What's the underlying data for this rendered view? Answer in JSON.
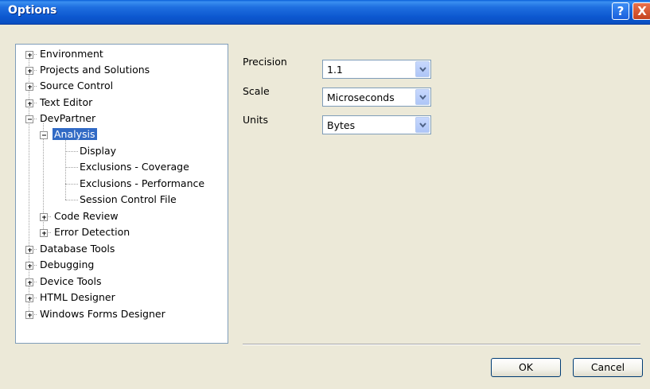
{
  "window": {
    "title": "Options"
  },
  "titlebar": {
    "help_glyph": "?",
    "close_glyph": "X"
  },
  "tree": {
    "items": [
      {
        "label": "Environment"
      },
      {
        "label": "Projects and Solutions"
      },
      {
        "label": "Source Control"
      },
      {
        "label": "Text Editor"
      },
      {
        "label": "DevPartner"
      },
      {
        "label": "Analysis",
        "selected": true
      },
      {
        "label": "Display"
      },
      {
        "label": "Exclusions - Coverage"
      },
      {
        "label": "Exclusions - Performance"
      },
      {
        "label": "Session Control File"
      },
      {
        "label": "Code Review"
      },
      {
        "label": "Error Detection"
      },
      {
        "label": "Database Tools"
      },
      {
        "label": "Debugging"
      },
      {
        "label": "Device Tools"
      },
      {
        "label": "HTML Designer"
      },
      {
        "label": "Windows Forms Designer"
      }
    ]
  },
  "settings": {
    "precision": {
      "label": "Precision",
      "value": "1.1"
    },
    "scale": {
      "label": "Scale",
      "value": "Microseconds"
    },
    "units": {
      "label": "Units",
      "value": "Bytes"
    }
  },
  "buttons": {
    "ok": "OK",
    "cancel": "Cancel"
  },
  "colors": {
    "selection": "#316ac5",
    "titlebar": "#0c58d0",
    "dialog_bg": "#ece9d8"
  }
}
